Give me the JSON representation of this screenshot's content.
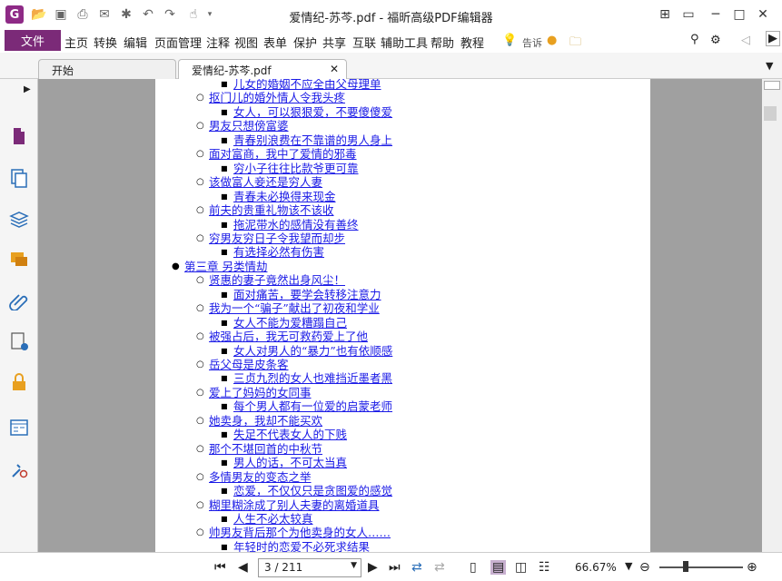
{
  "window": {
    "title": "爱情纪-苏芩.pdf - 福昕高级PDF编辑器"
  },
  "app_logo": "G",
  "menu": {
    "file": "文件",
    "items": [
      "主页",
      "转换",
      "编辑",
      "页面管理",
      "注释",
      "视图",
      "表单",
      "保护",
      "共享",
      "互联",
      "辅助工具",
      "帮助",
      "教程"
    ],
    "tell": "告诉",
    "search_placeholder": "查找"
  },
  "tabs": [
    {
      "label": "开始"
    },
    {
      "label": "爱情纪-苏芩.pdf"
    }
  ],
  "outline": [
    {
      "text": "儿女的婚姻不应全由父母理单",
      "level": 2
    },
    {
      "text": "抠门儿的婚外情人令我头疼",
      "level": 1
    },
    {
      "text": "女人，可以狠狠爱，不要傻傻爱",
      "level": 2
    },
    {
      "text": "男友只想傍富婆",
      "level": 1
    },
    {
      "text": "青春别浪费在不靠谱的男人身上",
      "level": 2
    },
    {
      "text": "面对富商，我中了爱情的邪毒",
      "level": 1
    },
    {
      "text": "穷小子往往比款爷更可靠",
      "level": 2
    },
    {
      "text": "该做富人妾还是穷人妻",
      "level": 1
    },
    {
      "text": "青春未必换得来现金",
      "level": 2
    },
    {
      "text": "前夫的贵重礼物该不该收",
      "level": 1
    },
    {
      "text": "拖泥带水的感情没有善终",
      "level": 2
    },
    {
      "text": "穷男友穷日子令我望而却步",
      "level": 1
    },
    {
      "text": "有选择必然有伤害",
      "level": 2
    },
    {
      "text": "第三章 另类情劫",
      "level": 0
    },
    {
      "text": "贤惠的妻子竟然出身风尘！",
      "level": 1
    },
    {
      "text": "面对痛苦，要学会转移注意力",
      "level": 2
    },
    {
      "text": "我为一个“骗子”献出了初夜和学业",
      "level": 1
    },
    {
      "text": "女人不能为爱糟蹋自己",
      "level": 2
    },
    {
      "text": "被强占后，我无可救药爱上了他",
      "level": 1
    },
    {
      "text": "女人对男人的“暴力”也有依顺感",
      "level": 2
    },
    {
      "text": "岳父母是皮条客",
      "level": 1
    },
    {
      "text": "三贞九烈的女人也难挡近墨者黑",
      "level": 2
    },
    {
      "text": "爱上了妈妈的女同事",
      "level": 1
    },
    {
      "text": "每个男人都有一位爱的启蒙老师",
      "level": 2
    },
    {
      "text": "她卖身，我却不能买欢",
      "level": 1
    },
    {
      "text": "失足不代表女人的下贱",
      "level": 2
    },
    {
      "text": "那个不堪回首的中秋节",
      "level": 1
    },
    {
      "text": "男人的话，不可太当真",
      "level": 2
    },
    {
      "text": "多情男友的变态之举",
      "level": 1
    },
    {
      "text": "恋爱，不仅仅只是贪图爱的感觉",
      "level": 2
    },
    {
      "text": "糊里糊涂成了别人夫妻的离婚道具",
      "level": 1
    },
    {
      "text": "人生不必太较真",
      "level": 2
    },
    {
      "text": "帅男友背后那个为他卖身的女人……",
      "level": 1
    },
    {
      "text": "年轻时的恋爱不必死求结果",
      "level": 2
    }
  ],
  "status": {
    "page": "3 / 211",
    "zoom": "66.67%"
  }
}
